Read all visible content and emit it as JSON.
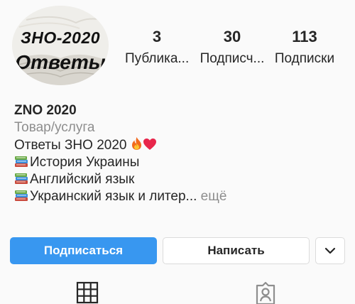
{
  "profile": {
    "avatar_text_line1": "ЗНО-2020",
    "avatar_text_line2": "Ответы",
    "name": "ZNO 2020",
    "category": "Товар/услуга",
    "bio_line1": "Ответы ЗНО 2020",
    "bio_line2": "История Украины",
    "bio_line3": "Английский язык",
    "bio_line4": "Украинский язык и литер...",
    "more_label": " ещё"
  },
  "stats": {
    "posts_count": "3",
    "posts_label": "Публика...",
    "followers_count": "30",
    "followers_label": "Подписч...",
    "following_count": "113",
    "following_label": "Подписки"
  },
  "actions": {
    "follow_label": "Подписаться",
    "message_label": "Написать"
  },
  "tabs": {
    "grid_icon": "grid-icon",
    "tagged_icon": "tagged-icon"
  },
  "colors": {
    "accent": "#3897f0",
    "secondary_text": "#8e8e8e",
    "border": "#dbdbdb"
  }
}
